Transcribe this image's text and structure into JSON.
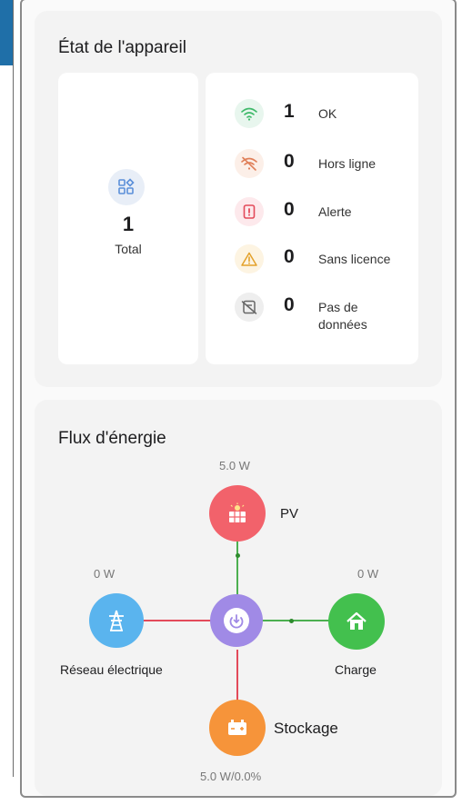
{
  "device_status": {
    "title": "État de l'appareil",
    "total": {
      "value": "1",
      "label": "Total",
      "icon": "grid-icon"
    },
    "rows": [
      {
        "count": "1",
        "label": "OK",
        "icon": "wifi-icon",
        "color": "#3fb96a",
        "bg": "#e8f6ee"
      },
      {
        "count": "0",
        "label": "Hors ligne",
        "icon": "wifi-off-icon",
        "color": "#e0805a",
        "bg": "#fcefe8"
      },
      {
        "count": "0",
        "label": "Alerte",
        "icon": "alert-lock-icon",
        "color": "#e34a5a",
        "bg": "#fde9ec"
      },
      {
        "count": "0",
        "label": "Sans licence",
        "icon": "warning-icon",
        "color": "#e3a12b",
        "bg": "#fdf4e2"
      },
      {
        "count": "0",
        "label": "Pas de données",
        "icon": "no-data-icon",
        "color": "#666666",
        "bg": "#eeeeee"
      }
    ]
  },
  "energy_flow": {
    "title": "Flux d'énergie",
    "pv": {
      "label": "PV",
      "value": "5.0 W",
      "color": "#f2626b"
    },
    "grid": {
      "label": "Réseau électrique",
      "value": "0 W",
      "color": "#5ab4ee"
    },
    "load": {
      "label": "Charge",
      "value": "0 W",
      "color": "#43c04e"
    },
    "storage": {
      "label": "Stockage",
      "value": "5.0 W/0.0%",
      "color": "#f6943a"
    },
    "center": {
      "color": "#a08ae6"
    }
  }
}
